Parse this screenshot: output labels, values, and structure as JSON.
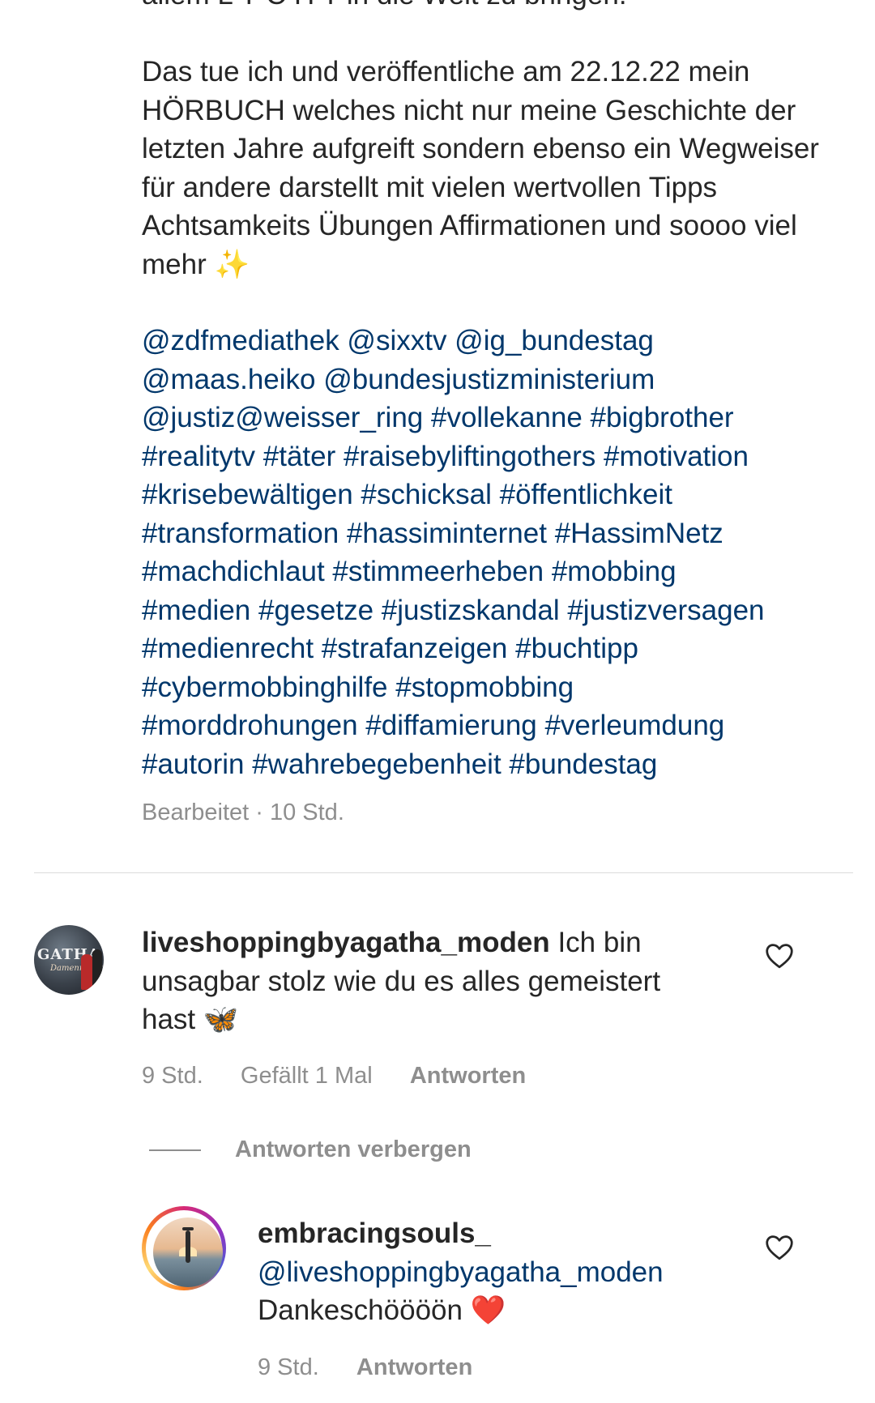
{
  "post": {
    "caption_cut_line": "allem L Y C H T in die Welt zu bringen.",
    "caption_paragraph": "Das tue ich und veröffentliche am 22.12.22 mein HÖRBUCH welches nicht nur meine Geschichte der letzten Jahre aufgreift sondern ebenso ein Wegweiser für andere darstellt mit vielen wertvollen Tipps Achtsamkeits Übungen Affirmationen und soooo viel mehr ✨",
    "caption_tags_lines": [
      "@zdfmediathek @sixxtv @ig_bundestag",
      "@maas.heiko @bundesjustizministerium",
      "@justiz@weisser_ring #vollekanne #bigbrother",
      "#realitytv #täter #raisebyliftingothers #motivation",
      "#krisebewältigen #schicksal #öffentlichkeit",
      "#transformation #hassiminternet #HassimNetz",
      "#machdichlaut #stimmeerheben #mobbing",
      "#medien #gesetze #justizskandal #justizversagen",
      "#medienrecht #strafanzeigen #buchtipp",
      "#cybermobbinghilfe #stopmobbing",
      "#morddrohungen #diffamierung #verleumdung",
      "#autorin #wahrebegebenheit #bundestag"
    ],
    "meta": "Bearbeitet · 10 Std."
  },
  "comment": {
    "username": "liveshoppingbyagatha_moden",
    "text": "Ich bin unsagbar stolz wie du es alles gemeistert hast 🦋",
    "avatar_text": "GATHA",
    "avatar_script": "Damenmoden",
    "time": "9 Std.",
    "likes": "Gefällt 1 Mal",
    "reply_label": "Antworten",
    "hide_replies_label": "Antworten verbergen"
  },
  "reply": {
    "username": "embracingsouls_",
    "mention": "@liveshoppingbyagatha_moden",
    "text": "Dankeschöööön ❤️",
    "time": "9 Std.",
    "reply_label": "Antworten"
  },
  "icons": {
    "like": "heart-outline-icon"
  },
  "colors": {
    "text": "#262626",
    "link": "#00376b",
    "muted": "#8e8e8e",
    "divider": "#dbdbdb"
  }
}
